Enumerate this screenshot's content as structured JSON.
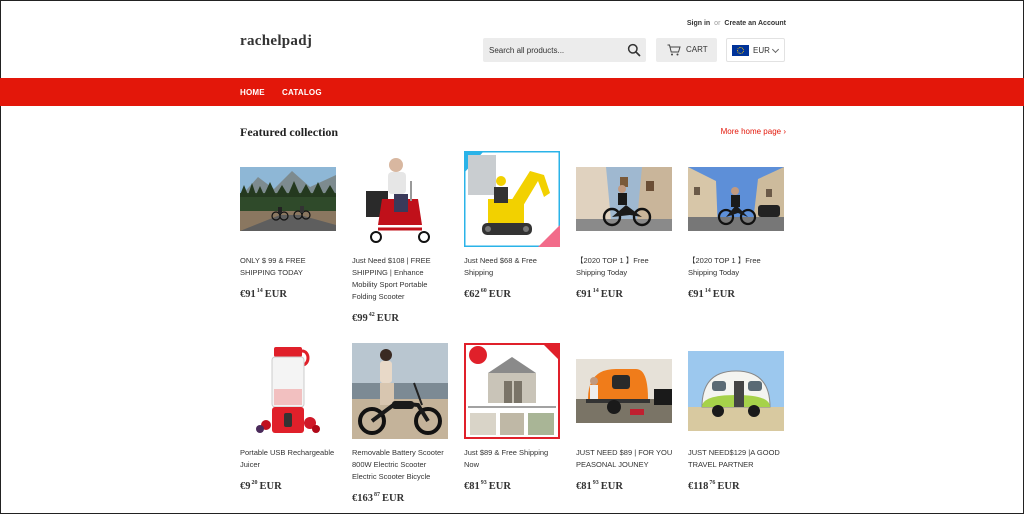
{
  "header": {
    "brand": "rachelpadj",
    "account": {
      "sign_in": "Sign in",
      "or": "or",
      "create": "Create an Account"
    },
    "search": {
      "placeholder": "Search all products...",
      "icon": "search-icon"
    },
    "cart": {
      "label": "CART",
      "icon": "cart-icon"
    },
    "currency": {
      "label": "EUR",
      "flag": "eu-flag-icon"
    }
  },
  "nav": {
    "items": [
      {
        "label": "HOME"
      },
      {
        "label": "CATALOG"
      }
    ],
    "color": "#e3170a"
  },
  "section": {
    "title": "Featured collection",
    "more": "More home page ›"
  },
  "products": [
    {
      "title": "ONLY $ 99 & FREE SHIPPING TODAY",
      "price_main": "€91",
      "price_cents": "14",
      "currency": "EUR",
      "image": "mountain-road-riders"
    },
    {
      "title": "Just Need $108 | FREE SHIPPING | Enhance Mobility Sport Portable Folding Scooter",
      "price_main": "€99",
      "price_cents": "42",
      "currency": "EUR",
      "image": "mobility-scooter"
    },
    {
      "title": "Just Need $68 & Free Shipping",
      "price_main": "€62",
      "price_cents": "60",
      "currency": "EUR",
      "image": "mini-excavator"
    },
    {
      "title": "【2020 TOP 1 】Free Shipping Today",
      "price_main": "€91",
      "price_cents": "14",
      "currency": "EUR",
      "image": "street-ebike"
    },
    {
      "title": "【2020 TOP 1 】Free Shipping Today",
      "price_main": "€91",
      "price_cents": "14",
      "currency": "EUR",
      "image": "street-ebike-2"
    },
    {
      "title": "Portable USB Rechargeable Juicer",
      "price_main": "€9",
      "price_cents": "20",
      "currency": "EUR",
      "image": "red-juicer"
    },
    {
      "title": "Removable Battery Scooter 800W Electric Scooter Electric Scooter Bicycle",
      "price_main": "€163",
      "price_cents": "87",
      "currency": "EUR",
      "image": "electric-chopper"
    },
    {
      "title": "Just $89 & Free Shipping Now",
      "price_main": "€81",
      "price_cents": "93",
      "currency": "EUR",
      "image": "storage-shed"
    },
    {
      "title": "JUST NEED $89 | FOR YOU PEASONAL JOUNEY",
      "price_main": "€81",
      "price_cents": "93",
      "currency": "EUR",
      "image": "orange-teardrop-trailer"
    },
    {
      "title": "JUST NEED$129 |A GOOD TRAVEL PARTNER",
      "price_main": "€118",
      "price_cents": "76",
      "currency": "EUR",
      "image": "green-camper-trailer"
    }
  ]
}
